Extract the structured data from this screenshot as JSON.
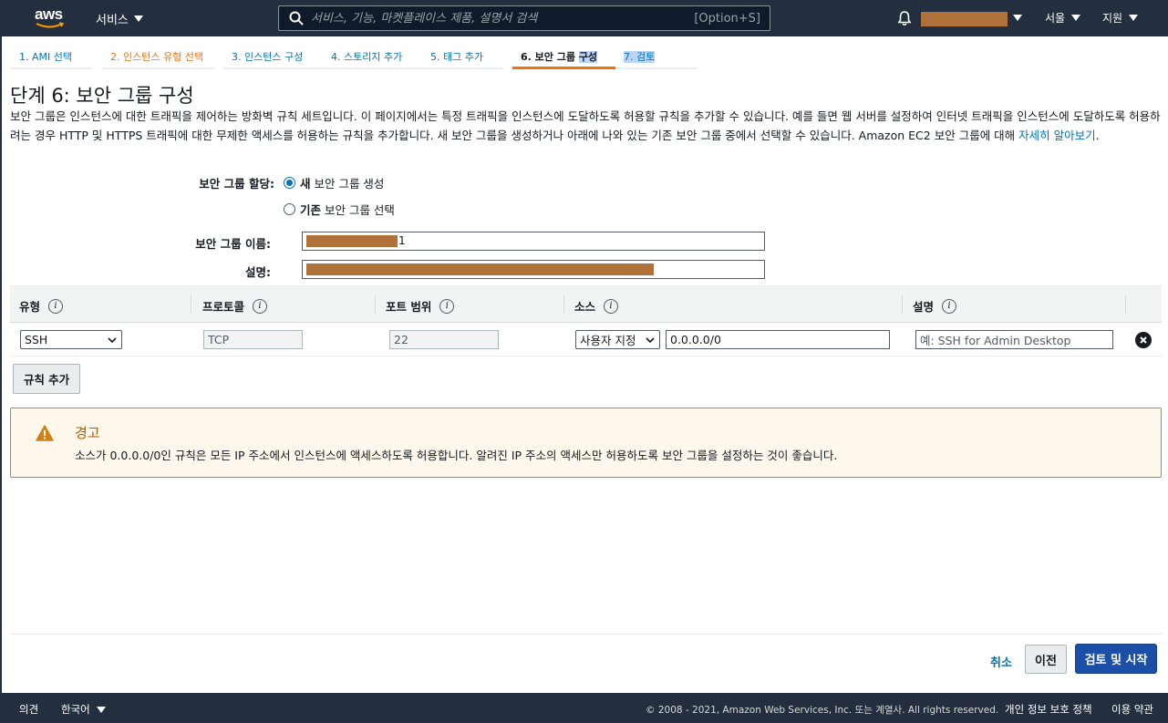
{
  "topnav": {
    "logo_text": "aws",
    "services_label": "서비스",
    "search_placeholder": "서비스, 기능, 마켓플레이스 제품, 설명서 검색",
    "search_shortcut": "[Option+S]",
    "region_label": "서울",
    "support_label": "지원"
  },
  "wizard_tabs": [
    {
      "label": "1. AMI 선택"
    },
    {
      "label": "2. 인스턴스 유형 선택"
    },
    {
      "label": "3. 인스턴스 구성"
    },
    {
      "label": "4. 스토리지 추가"
    },
    {
      "label": "5. 태그 추가"
    },
    {
      "label_a": "6. 보안 그룹 ",
      "label_b": "구성"
    },
    {
      "label": "7. 검토"
    }
  ],
  "page": {
    "title": "단계 6: 보안 그룹 구성",
    "description": "보안 그룹은 인스턴스에 대한 트래픽을 제어하는 방화벽 규칙 세트입니다. 이 페이지에서는 특정 트래픽을 인스턴스에 도달하도록 허용할 규칙을 추가할 수 있습니다. 예를 들면 웹 서버를 설정하여 인터넷 트래픽을 인스턴스에 도달하도록 허용하려는 경우 HTTP 및 HTTPS 트래픽에 대한 무제한 액세스를 허용하는 규칙을 추가합니다. 새 보안 그룹을 생성하거나 아래에 나와 있는 기존 보안 그룹 중에서 선택할 수 있습니다. Amazon EC2 보안 그룹에 대해 ",
    "learn_more": "자세히 알아보기",
    "period": "."
  },
  "form": {
    "assign_label": "보안 그룹 할당:",
    "radio_new_bold": "새",
    "radio_new_rest": " 보안 그룹 생성",
    "radio_existing_bold": "기존",
    "radio_existing_rest": " 보안 그룹 선택",
    "name_label": "보안 그룹 이름:",
    "name_suffix": "1",
    "desc_label": "설명:"
  },
  "table": {
    "headers": [
      "유형",
      "프로토콜",
      "포트 범위",
      "소스",
      "설명"
    ],
    "info_glyph": "i",
    "row": {
      "type": "SSH",
      "protocol": "TCP",
      "port_range": "22",
      "source_mode": "사용자 지정",
      "source_cidr": "0.0.0.0/0",
      "description_placeholder": "예: SSH for Admin Desktop"
    }
  },
  "add_rule_label": "규칙 추가",
  "warning": {
    "title": "경고",
    "text": "소스가 0.0.0.0/0인 규칙은 모든 IP 주소에서 인스턴스에 액세스하도록 허용합니다. 알려진 IP 주소의 액세스만 허용하도록 보안 그룹을 설정하는 것이 좋습니다."
  },
  "actions": {
    "cancel": "취소",
    "previous": "이전",
    "review_launch": "검토 및 시작"
  },
  "footer": {
    "feedback": "의견",
    "language": "한국어",
    "copyright": "© 2008 - 2021, Amazon Web Services, Inc. 또는 계열사. All rights reserved.",
    "privacy": "개인 정보 보호 정책",
    "terms": "이용 약관"
  },
  "colors": {
    "nav_bg": "#232f3e",
    "accent_orange": "#ec7211",
    "link_blue": "#0073bb",
    "primary_button": "#1c4fa8",
    "warning_bg": "#fef8ec",
    "warning_border": "#d08118",
    "redaction": "#b07238"
  }
}
